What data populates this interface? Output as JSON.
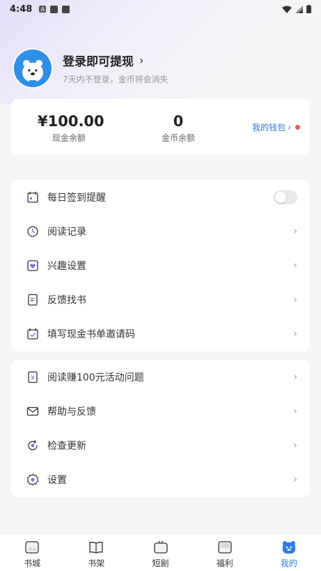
{
  "status_bar": {
    "time": "4:48"
  },
  "profile": {
    "login_label": "登录即可提现",
    "subtitle": "7天内不登录，金币将会消失"
  },
  "wallet": {
    "cash_value": "¥100.00",
    "cash_label": "现金余额",
    "gold_value": "0",
    "gold_label": "金币余额",
    "wallet_link": "我的钱包"
  },
  "menu_group1": [
    {
      "label": "每日签到提醒",
      "icon": "calendar-icon"
    },
    {
      "label": "阅读记录",
      "icon": "clock-icon"
    },
    {
      "label": "兴趣设置",
      "icon": "heart-icon"
    },
    {
      "label": "反馈找书",
      "icon": "document-icon"
    },
    {
      "label": "填写现金书单邀请码",
      "icon": "check-calendar-icon"
    }
  ],
  "menu_group2": [
    {
      "label": "阅读赚100元活动问题",
      "icon": "yuan-icon"
    },
    {
      "label": "帮助与反馈",
      "icon": "mail-icon"
    },
    {
      "label": "检查更新",
      "icon": "refresh-icon"
    },
    {
      "label": "设置",
      "icon": "gear-icon"
    }
  ],
  "tabs": [
    {
      "label": "书城",
      "icon": "bookstore-icon"
    },
    {
      "label": "书架",
      "icon": "bookshelf-icon"
    },
    {
      "label": "短剧",
      "icon": "tv-icon"
    },
    {
      "label": "福利",
      "icon": "gift-icon"
    },
    {
      "label": "我的",
      "icon": "profile-bear-icon"
    }
  ],
  "colors": {
    "accent": "#2f7de8",
    "link": "#2f6fd6",
    "badge": "#f25555",
    "icon_purple": "#7b6fe0"
  }
}
